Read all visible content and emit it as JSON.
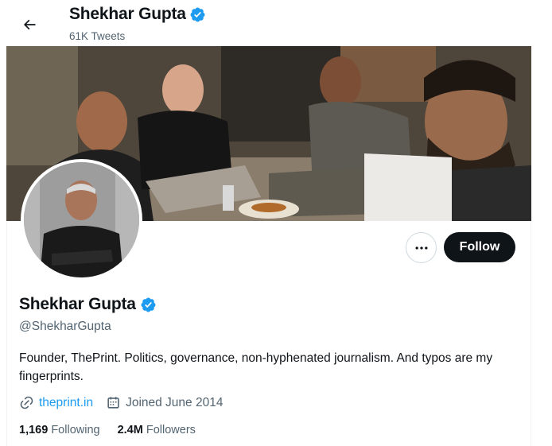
{
  "header": {
    "display_name": "Shekhar Gupta",
    "tweet_count": "61K Tweets"
  },
  "profile": {
    "display_name": "Shekhar Gupta",
    "handle": "@ShekharGupta",
    "bio": "Founder, ThePrint. Politics, governance, non-hyphenated journalism. And typos are my fingerprints.",
    "website": "theprint.in",
    "joined": "Joined June 2014",
    "following_count": "1,169",
    "following_label": "Following",
    "followers_count": "2.4M",
    "followers_label": "Followers"
  },
  "actions": {
    "follow_label": "Follow"
  },
  "icons": {
    "back": "arrow-left-icon",
    "verified": "verified-badge-icon",
    "more": "more-horizontal-icon",
    "link": "link-icon",
    "calendar": "calendar-icon"
  },
  "colors": {
    "accent": "#1d9bf0",
    "text_primary": "#0f1419",
    "text_secondary": "#536471",
    "follow_bg": "#0f1419"
  }
}
